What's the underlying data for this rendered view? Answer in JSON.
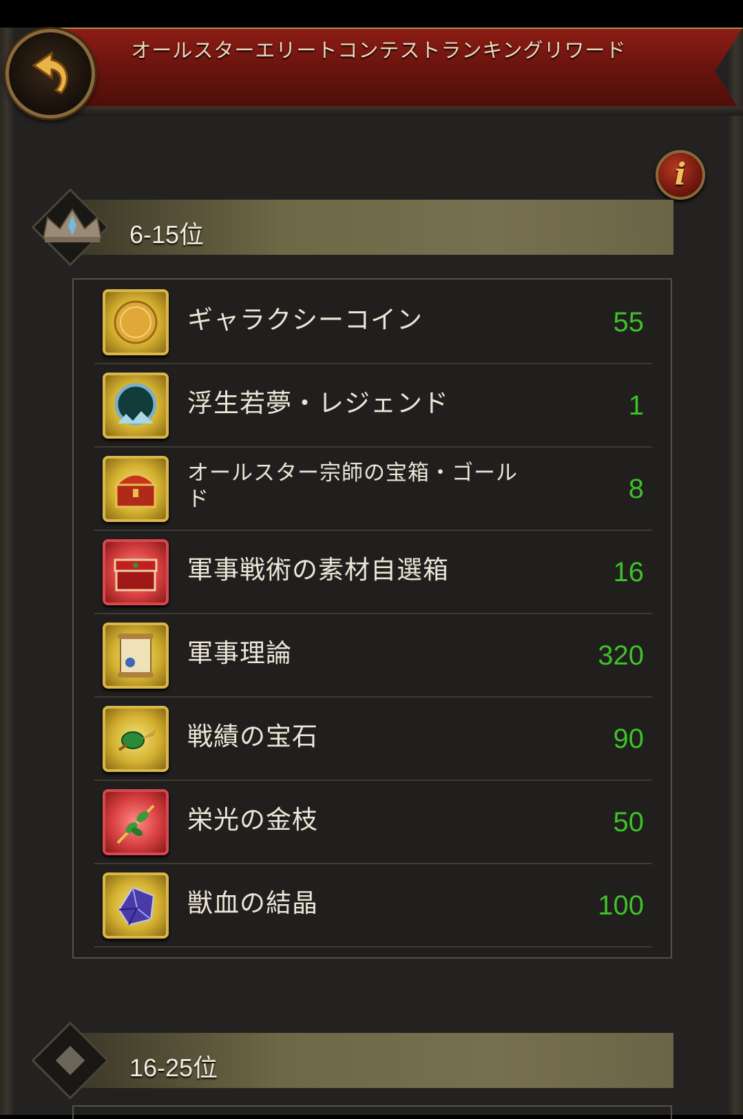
{
  "header": {
    "title": "オールスターエリートコンテストランキングリワード"
  },
  "sections": [
    {
      "rank_label": "6-15位",
      "rewards": [
        {
          "name": "ギャラクシーコイン",
          "qty": "55",
          "icon": "all-star-coin-icon",
          "frame": "gold"
        },
        {
          "name": "浮生若夢・レジェンド",
          "qty": "1",
          "icon": "dream-mirror-icon",
          "frame": "gold"
        },
        {
          "name": "オールスター宗師の宝箱・ゴールド",
          "qty": "8",
          "icon": "treasure-chest-icon",
          "frame": "gold"
        },
        {
          "name": "軍事戦術の素材自選箱",
          "qty": "16",
          "icon": "red-chest-icon",
          "frame": "red"
        },
        {
          "name": "軍事理論",
          "qty": "320",
          "icon": "scroll-icon",
          "frame": "gold"
        },
        {
          "name": "戦績の宝石",
          "qty": "90",
          "icon": "green-gem-icon",
          "frame": "gold"
        },
        {
          "name": "栄光の金枝",
          "qty": "50",
          "icon": "golden-branch-icon",
          "frame": "red"
        },
        {
          "name": "獣血の結晶",
          "qty": "100",
          "icon": "blood-crystal-icon",
          "frame": "gold"
        }
      ]
    },
    {
      "rank_label": "16-25位"
    }
  ],
  "colors": {
    "quantity": "#3ec12a",
    "banner": "#8c1d14",
    "gold_frame": "#d9b74a",
    "red_frame": "#d84850"
  }
}
